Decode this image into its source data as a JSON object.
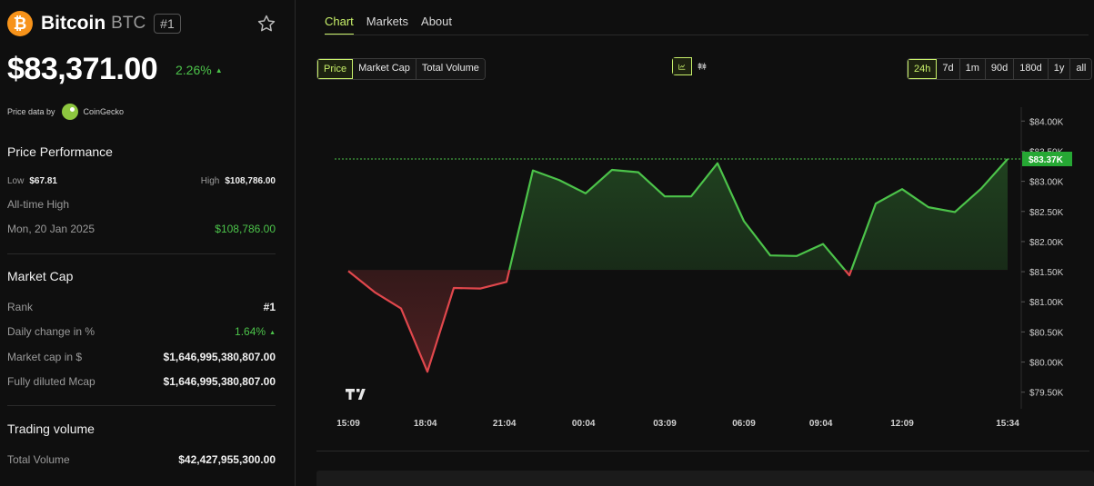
{
  "coin": {
    "logo_glyph": "₿",
    "name": "Bitcoin",
    "symbol": "BTC",
    "rank_badge": "#1"
  },
  "price": {
    "value": "$83,371.00",
    "change": "2.26%",
    "change_arrow": "▲"
  },
  "price_data": {
    "label": "Price data by",
    "provider": "CoinGecko"
  },
  "performance": {
    "title": "Price Performance",
    "low_label": "Low",
    "low_value": "$67.81",
    "high_label": "High",
    "high_value": "$108,786.00",
    "ath_label": "All-time High",
    "ath_date": "Mon, 20 Jan 2025",
    "ath_value": "$108,786.00"
  },
  "market_cap": {
    "title": "Market Cap",
    "rank_label": "Rank",
    "rank_value": "#1",
    "daily_label": "Daily change in %",
    "daily_value": "1.64%",
    "daily_arrow": "▲",
    "mcap_label": "Market cap in $",
    "mcap_value": "$1,646,995,380,807.00",
    "fdv_label": "Fully diluted Mcap",
    "fdv_value": "$1,646,995,380,807.00"
  },
  "trading": {
    "title": "Trading volume",
    "total_label": "Total Volume",
    "total_value": "$42,427,955,300.00"
  },
  "tabs": [
    "Chart",
    "Markets",
    "About"
  ],
  "metric_buttons": [
    "Price",
    "Market Cap",
    "Total Volume"
  ],
  "range_buttons": [
    "24h",
    "7d",
    "1m",
    "90d",
    "180d",
    "1y",
    "all"
  ],
  "colors": {
    "accent": "#c8f06a",
    "up": "#4cc34a",
    "down": "#e0474c"
  },
  "icons": {
    "star": "star-icon",
    "line_chart": "line-chart-icon",
    "candle": "candlestick-icon",
    "watermark": "tradingview-logo"
  },
  "chart_data": {
    "type": "line",
    "baseline": 81530,
    "current_label": "$83.37K",
    "x": [
      "15:09",
      "16:09",
      "17:09",
      "18:09",
      "19:09",
      "20:09",
      "21:09",
      "22:09",
      "23:09",
      "00:09",
      "01:09",
      "02:09",
      "03:09",
      "04:09",
      "05:09",
      "06:09",
      "07:09",
      "08:09",
      "09:09",
      "10:09",
      "11:09",
      "12:09",
      "13:09",
      "14:09",
      "15:09",
      "15:34"
    ],
    "values": [
      81510,
      81160,
      80890,
      79840,
      81230,
      81220,
      81330,
      83180,
      83020,
      82800,
      83190,
      83150,
      82750,
      82750,
      83300,
      82340,
      81770,
      81760,
      81960,
      81440,
      82630,
      82870,
      82570,
      82490,
      82880,
      83371
    ],
    "x_ticks": [
      "15:09",
      "18:04",
      "21:04",
      "00:04",
      "03:09",
      "06:09",
      "09:04",
      "12:09",
      "15:34"
    ],
    "y_ticks": [
      "$84.00K",
      "$83.50K",
      "$83.00K",
      "$82.50K",
      "$82.00K",
      "$81.50K",
      "$81.00K",
      "$80.50K",
      "$80.00K",
      "$79.50K"
    ],
    "y_tick_values": [
      84000,
      83500,
      83000,
      82500,
      82000,
      81500,
      81000,
      80500,
      80000,
      79500
    ],
    "ylim": [
      79300,
      84200
    ]
  }
}
